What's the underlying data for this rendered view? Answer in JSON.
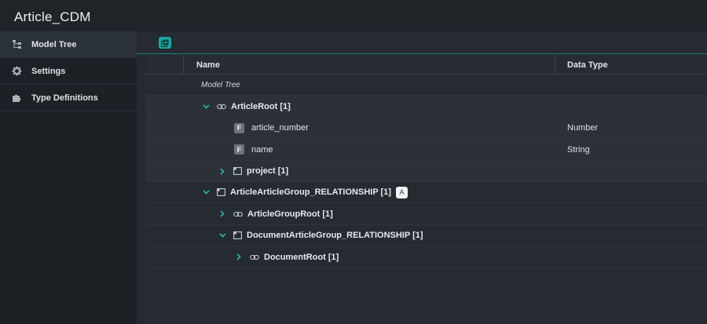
{
  "app": {
    "title": "Article_CDM"
  },
  "sidebar": {
    "items": [
      {
        "label": "Model Tree",
        "icon": "model-tree-icon",
        "active": true
      },
      {
        "label": "Settings",
        "icon": "gear-icon",
        "active": false
      },
      {
        "label": "Type Definitions",
        "icon": "puzzle-icon",
        "active": false
      }
    ]
  },
  "table": {
    "headers": {
      "name": "Name",
      "type": "Data Type"
    },
    "rows": [
      {
        "label": "Model Tree",
        "type": ""
      },
      {
        "label": "ArticleRoot [1]",
        "type": ""
      },
      {
        "label": "article_number",
        "type": "Number",
        "badge": "F"
      },
      {
        "label": "name",
        "type": "String",
        "badge": "F"
      },
      {
        "label": "project [1]",
        "type": ""
      },
      {
        "label": "ArticleArticleGroup_RELATIONSHIP [1]",
        "type": "",
        "tag": "A"
      },
      {
        "label": "ArticleGroupRoot [1]",
        "type": ""
      },
      {
        "label": "DocumentArticleGroup_RELATIONSHIP [1]",
        "type": ""
      },
      {
        "label": "DocumentRoot [1]",
        "type": ""
      }
    ]
  },
  "colors": {
    "accent": "#1aa9a3",
    "background": "#252b31",
    "sidebar": "#1c2126"
  }
}
